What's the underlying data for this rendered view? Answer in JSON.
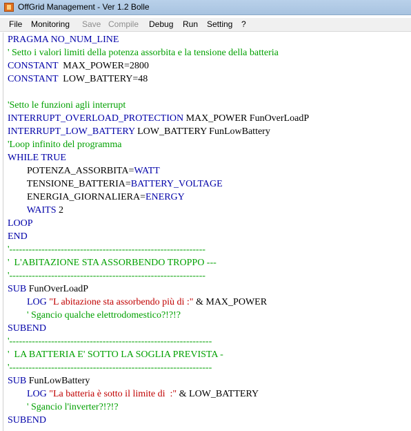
{
  "window": {
    "title": "OffGrid Management - Ver 1.2 Bolle"
  },
  "menu": {
    "items": [
      {
        "label": "File",
        "enabled": true
      },
      {
        "label": "Monitoring",
        "enabled": true
      },
      {
        "label": "Save",
        "enabled": false
      },
      {
        "label": "Compile",
        "enabled": false
      },
      {
        "label": "Debug",
        "enabled": true
      },
      {
        "label": "Run",
        "enabled": true
      },
      {
        "label": "Setting",
        "enabled": true
      },
      {
        "label": "?",
        "enabled": true
      }
    ]
  },
  "colors": {
    "keyword": "#0000a8",
    "comment": "#00a000",
    "string": "#c00000",
    "plain": "#000000"
  },
  "code": {
    "lines": [
      {
        "tokens": [
          {
            "text": "PRAGMA NO_NUM_LINE",
            "type": "kw"
          }
        ]
      },
      {
        "tokens": [
          {
            "text": "' Setto i valori limiti della potenza assorbita e la tensione della batteria",
            "type": "cm"
          }
        ]
      },
      {
        "tokens": [
          {
            "text": "CONSTANT ",
            "type": "kw"
          },
          {
            "text": " MAX_POWER=2800",
            "type": "plain"
          }
        ]
      },
      {
        "tokens": [
          {
            "text": "CONSTANT ",
            "type": "kw"
          },
          {
            "text": " LOW_BATTERY=48",
            "type": "plain"
          }
        ]
      },
      {
        "tokens": []
      },
      {
        "tokens": [
          {
            "text": "'Setto le funzioni agli interrupt",
            "type": "cm"
          }
        ]
      },
      {
        "tokens": [
          {
            "text": "INTERRUPT_OVERLOAD_PROTECTION",
            "type": "kw"
          },
          {
            "text": " MAX_POWER FunOverLoadP",
            "type": "plain"
          }
        ]
      },
      {
        "tokens": [
          {
            "text": "INTERRUPT_LOW_BATTERY",
            "type": "kw"
          },
          {
            "text": " LOW_BATTERY FunLowBattery",
            "type": "plain"
          }
        ]
      },
      {
        "tokens": [
          {
            "text": "'Loop infinito del programma",
            "type": "cm"
          }
        ]
      },
      {
        "tokens": [
          {
            "text": "WHILE TRUE",
            "type": "kw"
          }
        ]
      },
      {
        "tokens": [
          {
            "text": "        POTENZA_ASSORBITA=",
            "type": "plain"
          },
          {
            "text": "WATT",
            "type": "kw"
          }
        ]
      },
      {
        "tokens": [
          {
            "text": "        TENSIONE_BATTERIA=",
            "type": "plain"
          },
          {
            "text": "BATTERY_VOLTAGE",
            "type": "kw"
          }
        ]
      },
      {
        "tokens": [
          {
            "text": "        ENERGIA_GIORNALIERA=",
            "type": "plain"
          },
          {
            "text": "ENERGY",
            "type": "kw"
          }
        ]
      },
      {
        "tokens": [
          {
            "text": "        ",
            "type": "plain"
          },
          {
            "text": "WAITS",
            "type": "kw"
          },
          {
            "text": " 2",
            "type": "plain"
          }
        ]
      },
      {
        "tokens": [
          {
            "text": "LOOP",
            "type": "kw"
          }
        ]
      },
      {
        "tokens": [
          {
            "text": "END",
            "type": "kw"
          }
        ]
      },
      {
        "tokens": [
          {
            "text": "'-------------------------------------------------------------",
            "type": "cm"
          }
        ]
      },
      {
        "tokens": [
          {
            "text": "'  L'ABITAZIONE STA ASSORBENDO TROPPO ---",
            "type": "cm"
          }
        ]
      },
      {
        "tokens": [
          {
            "text": "'-------------------------------------------------------------",
            "type": "cm"
          }
        ]
      },
      {
        "tokens": [
          {
            "text": "SUB",
            "type": "kw"
          },
          {
            "text": " FunOverLoadP",
            "type": "plain"
          }
        ]
      },
      {
        "tokens": [
          {
            "text": "        ",
            "type": "plain"
          },
          {
            "text": "LOG",
            "type": "kw"
          },
          {
            "text": " \"L abitazione sta assorbendo più di :\"",
            "type": "str"
          },
          {
            "text": " & MAX_POWER",
            "type": "plain"
          }
        ]
      },
      {
        "tokens": [
          {
            "text": "        ' Sgancio qualche elettrodomestico?!?!?",
            "type": "cm"
          }
        ]
      },
      {
        "tokens": [
          {
            "text": "SUBEND",
            "type": "kw"
          }
        ]
      },
      {
        "tokens": [
          {
            "text": "'---------------------------------------------------------------",
            "type": "cm"
          }
        ]
      },
      {
        "tokens": [
          {
            "text": "'  LA BATTERIA E' SOTTO LA SOGLIA PREVISTA -",
            "type": "cm"
          }
        ]
      },
      {
        "tokens": [
          {
            "text": "'---------------------------------------------------------------",
            "type": "cm"
          }
        ]
      },
      {
        "tokens": [
          {
            "text": "SUB",
            "type": "kw"
          },
          {
            "text": " FunLowBattery",
            "type": "plain"
          }
        ]
      },
      {
        "tokens": [
          {
            "text": "        ",
            "type": "plain"
          },
          {
            "text": "LOG",
            "type": "kw"
          },
          {
            "text": " \"La batteria è sotto il limite di  :\"",
            "type": "str"
          },
          {
            "text": " & LOW_BATTERY",
            "type": "plain"
          }
        ]
      },
      {
        "tokens": [
          {
            "text": "        ' Sgancio l'inverter?!?!?",
            "type": "cm"
          }
        ]
      },
      {
        "tokens": [
          {
            "text": "SUBEND",
            "type": "kw"
          }
        ]
      }
    ]
  }
}
